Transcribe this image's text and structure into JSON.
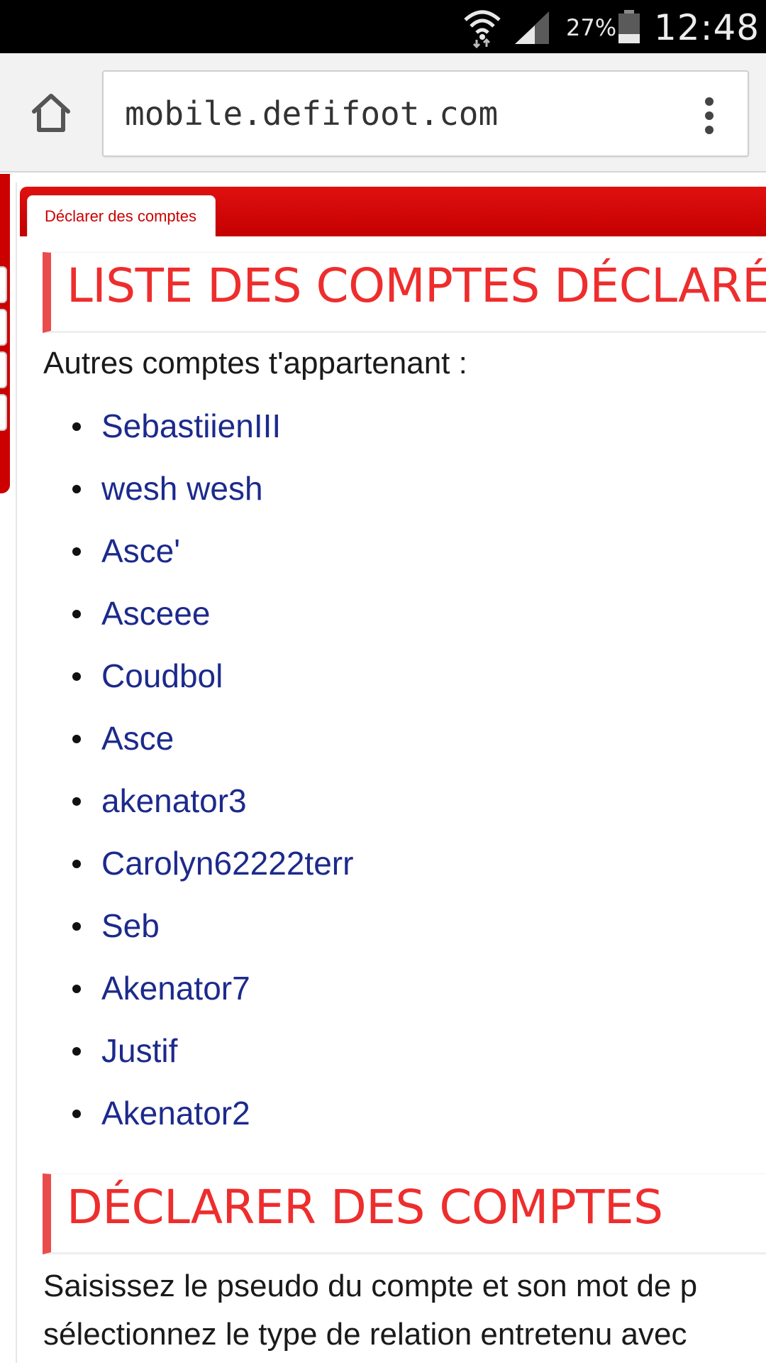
{
  "status_bar": {
    "battery_percent": "27%",
    "time": "12:48",
    "icons": [
      "wifi-icon",
      "signal-icon",
      "battery-icon"
    ]
  },
  "browser": {
    "url": "mobile.defifoot.com",
    "icons": [
      "home-icon",
      "more-vert-icon"
    ]
  },
  "tabs": [
    {
      "label": "Déclarer des comptes",
      "active": true
    }
  ],
  "section_list": {
    "heading": "LISTE DES COMPTES DÉCLARÉS",
    "intro": "Autres comptes t'appartenant :",
    "accounts": [
      "SebastiienIII",
      "wesh wesh",
      "Asce'",
      "Asceee",
      "Coudbol",
      "Asce",
      "akenator3",
      "Carolyn62222terr",
      "Seb",
      "Akenator7",
      "Justif",
      "Akenator2"
    ]
  },
  "section_declare": {
    "heading": "DÉCLARER DES COMPTES",
    "line1": "Saisissez le pseudo du compte et son mot de p",
    "line2": "sélectionnez le type de relation entretenu avec"
  },
  "colors": {
    "accent_red": "#cc0000",
    "heading_red": "#ee2d2d",
    "link_blue": "#1c2a8c"
  }
}
